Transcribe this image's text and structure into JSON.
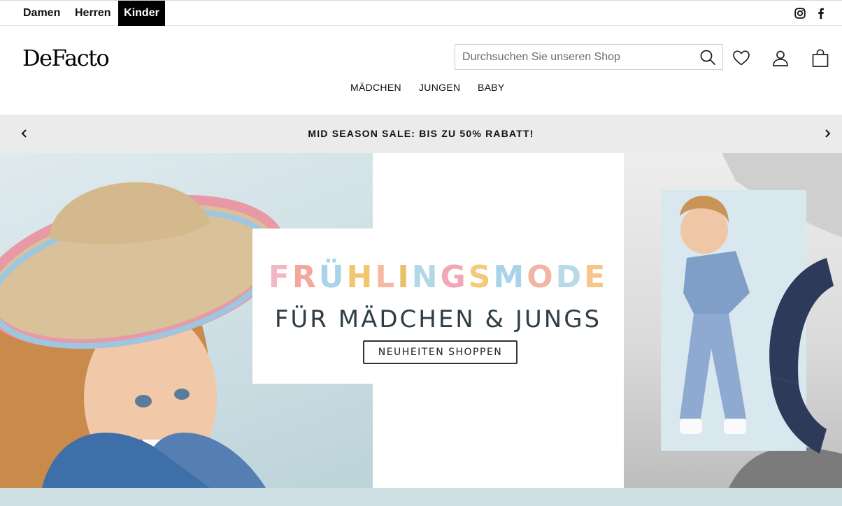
{
  "topbar": {
    "genders": [
      {
        "label": "Damen",
        "active": false
      },
      {
        "label": "Herren",
        "active": false
      },
      {
        "label": "Kinder",
        "active": true
      }
    ],
    "social_icons": [
      "instagram-icon",
      "facebook-icon"
    ]
  },
  "header": {
    "logo_text": "DeFacto",
    "search": {
      "placeholder": "Durchsuchen Sie unseren Shop",
      "value": ""
    },
    "icons": [
      "search-icon",
      "heart-icon",
      "user-icon",
      "bag-icon"
    ]
  },
  "nav": {
    "items": [
      "MÄDCHEN",
      "JUNGEN",
      "BABY"
    ]
  },
  "announcement": {
    "text": "MID SEASON SALE: BIS ZU 50% RABATT!"
  },
  "hero": {
    "headline": "FRÜHLINGSMODE",
    "headline_colors": [
      "#f3b6c4",
      "#f6a79c",
      "#a9d3e8",
      "#f4c56f",
      "#f7b8a0",
      "#e8c06a",
      "#b2d8e6",
      "#f2a6b6",
      "#f4c97a",
      "#a9d3e8",
      "#f2b4a4",
      "#b7d9e8",
      "#f6c58a"
    ],
    "subline": "FÜR MÄDCHEN & JUNGS",
    "cta_label": "NEUHEITEN SHOPPEN"
  },
  "colors": {
    "accent_black": "#000000",
    "announcement_bg": "#ebebeb",
    "hero_bg": "#c9dbe0"
  }
}
